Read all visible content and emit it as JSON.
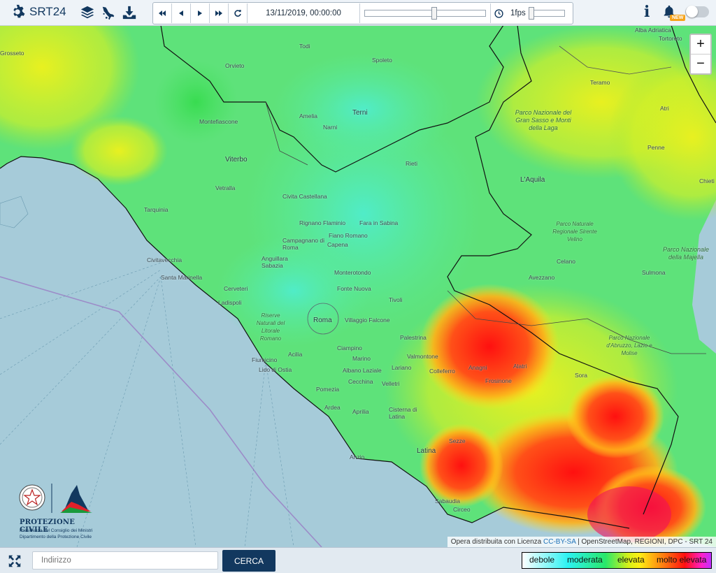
{
  "app": {
    "title": "SRT24"
  },
  "toolbar": {
    "icons": [
      "gear-icon",
      "layers-icon",
      "italy-map-icon",
      "download-icon"
    ],
    "player": {
      "datetime": "13/11/2019, 00:00:00",
      "fps_label": "1fps",
      "controls": [
        "first-frame-icon",
        "previous-frame-icon",
        "next-frame-icon",
        "last-frame-icon",
        "refresh-icon",
        "clock-icon"
      ],
      "position_fraction": 0.58,
      "fps_fraction": 0.0
    },
    "info_label": "i",
    "new_badge": "NEW",
    "toggle_on": false
  },
  "map": {
    "places": [
      {
        "name": "Todi"
      },
      {
        "name": "Orvieto"
      },
      {
        "name": "Spoleto"
      },
      {
        "name": "Terni"
      },
      {
        "name": "Amelia"
      },
      {
        "name": "Narni"
      },
      {
        "name": "Montefiascone"
      },
      {
        "name": "Viterbo"
      },
      {
        "name": "Rieti"
      },
      {
        "name": "L'Aquila"
      },
      {
        "name": "Vetralla"
      },
      {
        "name": "Civita Castellana"
      },
      {
        "name": "Tarquinia"
      },
      {
        "name": "Rignano Flaminio"
      },
      {
        "name": "Fara in Sabina"
      },
      {
        "name": "Fiano Romano"
      },
      {
        "name": "Capena"
      },
      {
        "name": "Campagnano di Roma"
      },
      {
        "name": "Anguillara Sabazia"
      },
      {
        "name": "Civitavecchia"
      },
      {
        "name": "Santa Marinella"
      },
      {
        "name": "Monterotondo"
      },
      {
        "name": "Cerveteri"
      },
      {
        "name": "Fonte Nuova"
      },
      {
        "name": "Ladispoli"
      },
      {
        "name": "Tivoli"
      },
      {
        "name": "Roma"
      },
      {
        "name": "Villaggio Falcone"
      },
      {
        "name": "Palestrina"
      },
      {
        "name": "Ciampino"
      },
      {
        "name": "Fiumicino"
      },
      {
        "name": "Marino"
      },
      {
        "name": "Acilia"
      },
      {
        "name": "Lido di Ostia"
      },
      {
        "name": "Valmontone"
      },
      {
        "name": "Albano Laziale"
      },
      {
        "name": "Lariano"
      },
      {
        "name": "Cecchina"
      },
      {
        "name": "Velletri"
      },
      {
        "name": "Colleferro"
      },
      {
        "name": "Pomezia"
      },
      {
        "name": "Ardea"
      },
      {
        "name": "Aprilia"
      },
      {
        "name": "Cisterna di Latina"
      },
      {
        "name": "Latina"
      },
      {
        "name": "Anzio"
      },
      {
        "name": "Sezze"
      },
      {
        "name": "Circeo"
      },
      {
        "name": "Sabaudia"
      },
      {
        "name": "Teramo"
      },
      {
        "name": "Penne"
      },
      {
        "name": "Celano"
      },
      {
        "name": "Avezzano"
      },
      {
        "name": "Sulmona"
      },
      {
        "name": "Sora"
      },
      {
        "name": "Alatri"
      },
      {
        "name": "Anagni"
      },
      {
        "name": "Frosinone"
      },
      {
        "name": "Tortoreto"
      },
      {
        "name": "Alba Adriatica"
      },
      {
        "name": "Atri"
      },
      {
        "name": "Chieti"
      },
      {
        "name": "Grosseto"
      }
    ],
    "parks": [
      {
        "name": "Parco Nazionale del Gran Sasso e Monti della Laga"
      },
      {
        "name": "Parco Naturale Regionale Sirente Velino"
      },
      {
        "name": "Parco Nazionale della Majella"
      },
      {
        "name": "Parco Nazionale d'Abruzzo, Lazio e Molise"
      },
      {
        "name": "Riserve Naturali del Litorale Romano"
      }
    ],
    "zoom_in": "+",
    "zoom_out": "−",
    "attribution_prefix": "Opera distribuita con Licenza",
    "attribution_license": "CC-BY-SA",
    "attribution_suffix": "| OpenStreetMap, REGIONI, DPC - SRT 24"
  },
  "logo": {
    "title": "PROTEZIONE CIVILE",
    "subtitle1": "Presidenza del Consiglio dei Ministri",
    "subtitle2": "Dipartimento della Protezione Civile"
  },
  "bottombar": {
    "address_placeholder": "Indirizzo",
    "search_button": "CERCA",
    "legend": [
      "debole",
      "moderata",
      "elevata",
      "molto elevata"
    ]
  },
  "colors": {
    "brand": "#12385f",
    "accent": "#f6a31a",
    "legend_weak": "#2df2f2",
    "legend_moderate": "#28e86a",
    "legend_high": "#ffef14",
    "legend_very_high": "#ff1010"
  }
}
